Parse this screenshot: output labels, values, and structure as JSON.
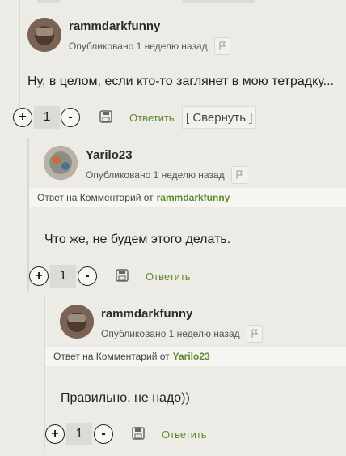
{
  "comments": [
    {
      "author": "rammdarkfunny",
      "meta": "Опубликовано 1 неделю назад",
      "text": "Ну, в целом, если кто-то заглянет в мою тетрадку...",
      "votes": "1",
      "plus": "+",
      "minus": "-",
      "reply_label": "Ответить",
      "collapse_label": "[ Свернуть ]"
    },
    {
      "author": "Yarilo23",
      "meta": "Опубликовано 1 неделю назад",
      "reply_prefix": "Ответ на Комментарий от",
      "reply_to": "rammdarkfunny",
      "text": "Что же, не будем этого делать.",
      "votes": "1",
      "plus": "+",
      "minus": "-",
      "reply_label": "Ответить"
    },
    {
      "author": "rammdarkfunny",
      "meta": "Опубликовано 1 неделю назад",
      "reply_prefix": "Ответ на Комментарий от",
      "reply_to": "Yarilo23",
      "text": "Правильно, не надо))",
      "votes": "1",
      "plus": "+",
      "minus": "-",
      "reply_label": "Ответить"
    }
  ],
  "colors": {
    "accent": "#5d8a2e",
    "background": "#ecebe5"
  },
  "icons": [
    "flag-icon",
    "save-icon",
    "avatar"
  ]
}
